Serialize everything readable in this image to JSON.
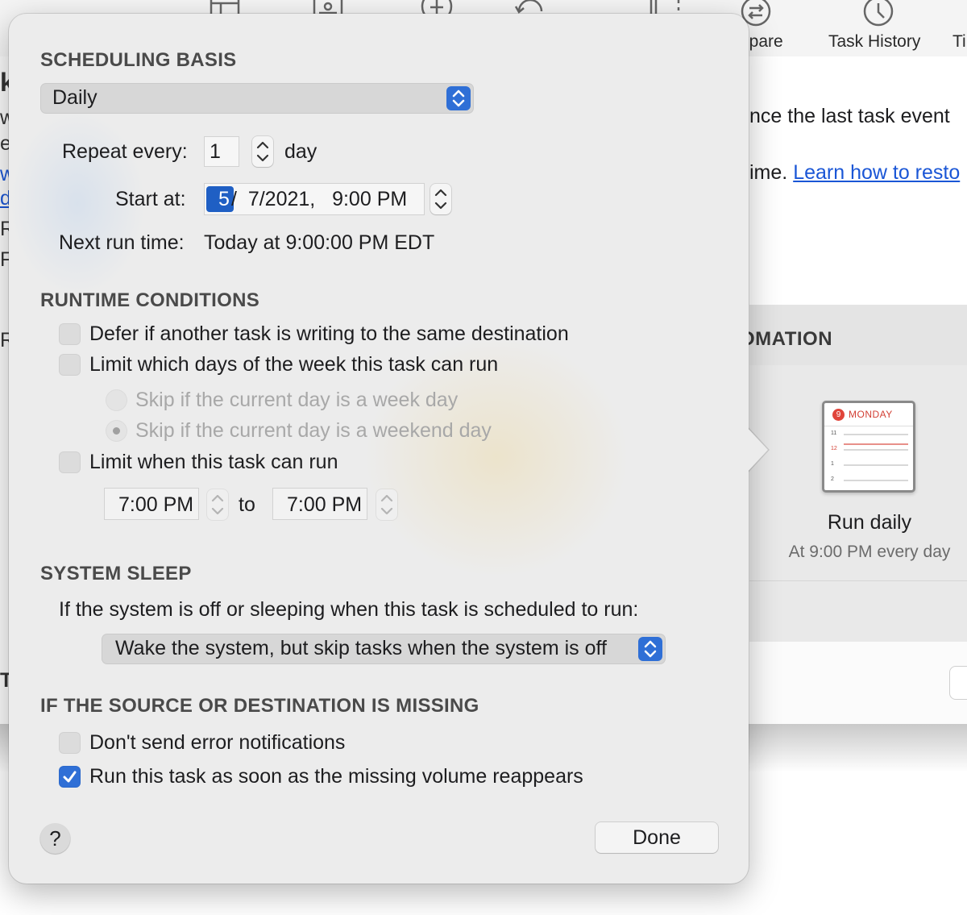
{
  "background": {
    "toolbar": {
      "items": [
        {
          "icon": "layout-icon",
          "label": ""
        },
        {
          "icon": "sliders-icon",
          "label": ""
        },
        {
          "icon": "add-icon",
          "label": ""
        },
        {
          "icon": "undo-icon",
          "label": ""
        },
        {
          "icon": "split-icon",
          "label": ""
        },
        {
          "icon": "compare-icon",
          "label": "npare"
        },
        {
          "icon": "clock-icon",
          "label": "Task History"
        },
        {
          "icon": "",
          "label": "Ti"
        }
      ]
    },
    "content": {
      "line1": "nce the last task event",
      "line2_prefix": "ime. ",
      "line2_link": "Learn how to resto"
    },
    "left_strip_chars": [
      "k",
      "w",
      "e",
      "w",
      "d",
      "R",
      "F",
      "R",
      "T"
    ],
    "automation_title": "OMATION",
    "calendar_icon": {
      "badge": "9",
      "day": "MONDAY",
      "rows": [
        "11",
        "12",
        "1",
        "2"
      ]
    },
    "run_title": "Run daily",
    "run_subtitle": "At 9:00 PM every day"
  },
  "popover": {
    "scheduling": {
      "title": "SCHEDULING BASIS",
      "basis_value": "Daily",
      "repeat_label": "Repeat every:",
      "repeat_value": "1",
      "repeat_unit": "day",
      "start_label": "Start at:",
      "start_segment_month": "5",
      "start_rest": "/  7/2021,   9:00 PM",
      "next_run_label": "Next run time:",
      "next_run_value": "Today at 9:00:00 PM EDT"
    },
    "runtime": {
      "title": "RUNTIME CONDITIONS",
      "defer_label": "Defer if another task is writing to the same destination",
      "defer_checked": false,
      "limit_days_label": "Limit which days of the week this task can run",
      "limit_days_checked": false,
      "skip_weekday_label": "Skip if the current day is a week day",
      "skip_weekend_label": "Skip if the current day is a weekend day",
      "skip_selected": "weekend",
      "limit_time_label": "Limit when this task can run",
      "limit_time_checked": false,
      "time_from": "7:00 PM",
      "time_to_label": "to",
      "time_to": "7:00 PM"
    },
    "sleep": {
      "title": "SYSTEM SLEEP",
      "description": "If the system is off or sleeping when this task is scheduled to run:",
      "option_value": "Wake the system, but skip tasks when the system is off"
    },
    "missing": {
      "title": "IF THE SOURCE OR DESTINATION IS MISSING",
      "no_errors_label": "Don't send error notifications",
      "no_errors_checked": false,
      "run_when_back_label": "Run this task as soon as the missing volume reappears",
      "run_when_back_checked": true
    },
    "footer": {
      "help_label": "?",
      "done_label": "Done"
    }
  },
  "colors": {
    "accent": "#2f6fd6",
    "popover_bg": "#ececec",
    "link": "#1a56d6"
  }
}
